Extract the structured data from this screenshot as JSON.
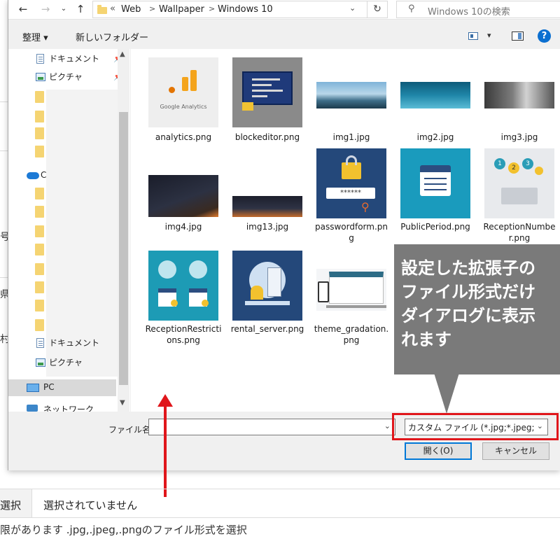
{
  "address_bar": {
    "back_icon": "arrow-left-icon",
    "forward_icon": "arrow-right-icon",
    "recent_icon": "chevron-down-icon",
    "up_icon": "arrow-up-icon",
    "overflow": "«",
    "breadcrumbs": [
      "Web",
      "Wallpaper",
      "Windows 10"
    ],
    "refresh_icon": "refresh-icon",
    "search_placeholder": "Windows 10の検索"
  },
  "toolbar": {
    "organize_label": "整理 ▾",
    "new_folder_label": "新しいフォルダー",
    "view_caret": "▾"
  },
  "nav_pane": {
    "quick_items": [
      {
        "label": "ドキュメント",
        "icon": "document-icon"
      },
      {
        "label": "ピクチャ",
        "icon": "pictures-icon"
      }
    ],
    "onedrive_initial": "C",
    "lower_items": [
      {
        "label": "ドキュメント",
        "icon": "document-icon"
      },
      {
        "label": "ピクチャ",
        "icon": "pictures-icon"
      }
    ],
    "pc_label": "PC",
    "network_label": "ネットワーク"
  },
  "files": [
    {
      "name": "analytics.png",
      "thumb_text": "Google Analytics"
    },
    {
      "name": "blockeditor.png"
    },
    {
      "name": "img1.jpg"
    },
    {
      "name": "img2.jpg"
    },
    {
      "name": "img3.jpg"
    },
    {
      "name": "img4.jpg"
    },
    {
      "name": "img13.jpg"
    },
    {
      "name": "passwordform.png",
      "thumb_text": "******"
    },
    {
      "name": "PublicPeriod.png"
    },
    {
      "name": "ReceptionNumber.png",
      "thumb_text": [
        "1",
        "2",
        "3"
      ]
    },
    {
      "name": "ReceptionRestrictions.png"
    },
    {
      "name": "rental_server.png"
    },
    {
      "name": "theme_gradation.png"
    }
  ],
  "dialog_footer": {
    "filename_label": "ファイル名(N):",
    "filename_value": "",
    "filter_value": "カスタム ファイル (*.jpg;*.jpeg;*.pn",
    "open_button": "開く(O)",
    "cancel_button": "キャンセル"
  },
  "annotation": {
    "callout_text": "設定した拡張子の\nファイル形式だけ\nダイアログに表示\nれます",
    "highlight_color": "#e0161b",
    "callout_color": "#7a7a7a"
  },
  "background_page": {
    "side_chars": [
      "号",
      "県",
      "村"
    ],
    "form_label": "選択",
    "form_value": "選択されていません",
    "note": "限があります .jpg,.jpeg,.pngのファイル形式を選択"
  }
}
